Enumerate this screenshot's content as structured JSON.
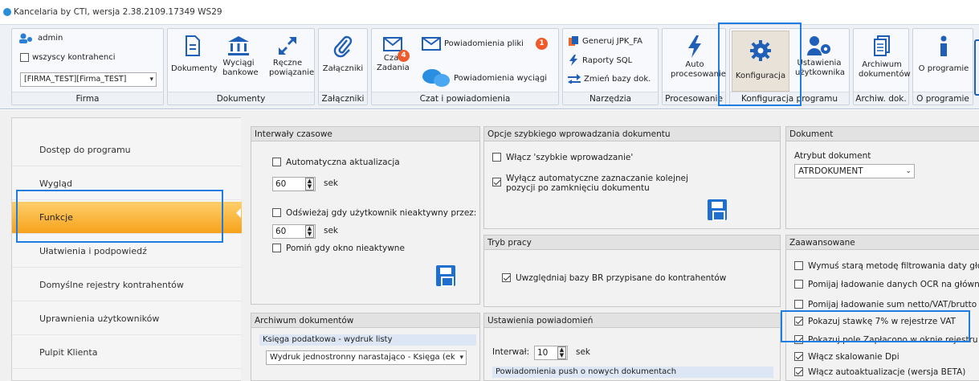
{
  "window": {
    "title": "Kancelaria by CTI, wersja  2.38.2109.17349 WS29"
  },
  "ribbon": {
    "firma": {
      "user": "admin",
      "all_contractors": "wszyscy kontrahenci",
      "firm_select": "[FIRMA_TEST][Firma_TEST]",
      "group_label": "Firma"
    },
    "dokumenty": {
      "dokumenty": "Dokumenty",
      "wyciagi": "Wyciągi bankowe",
      "reczne": "Ręczne powiązanie",
      "group_label": "Dokumenty"
    },
    "zalaczniki": {
      "button": "Załączniki",
      "group_label": "Załączniki"
    },
    "czat": {
      "czat": "Czat",
      "zadania": "Zadania",
      "zadania_badge": "4",
      "powiadomienia_pliki": "Powiadomienia pliki",
      "pliki_badge": "1",
      "powiadomienia_wyciagi": "Powiadomienia wyciągi",
      "group_label": "Czat i powiadomienia"
    },
    "narzedzia": {
      "jpk": "Generuj JPK_FA",
      "raporty": "Raporty SQL",
      "zmien": "Zmień bazy dok.",
      "group_label": "Narzędzia"
    },
    "procesowanie": {
      "button": "Auto procesowanie",
      "group_label": "Procesowanie"
    },
    "konfiguracja": {
      "konfiguracja": "Konfiguracja",
      "ustawienia": "Ustawienia użytkownika",
      "group_label": "Konfiguracja programu"
    },
    "archiwum": {
      "button": "Archiwum dokumentów",
      "group_label": "Archiw. dok."
    },
    "oprogramie": {
      "button": "O programie",
      "group_label": "O programie"
    }
  },
  "sidebar": {
    "items": [
      "Dostęp do programu",
      "Wygląd",
      "Funkcje",
      "Ułatwienia i podpowiedź",
      "Domyślne rejestry kontrahentów",
      "Uprawnienia użytkowników",
      "Pulpit Klienta"
    ]
  },
  "intervals": {
    "title": "Interwały czasowe",
    "auto_update": "Automatyczna aktualizacja",
    "auto_value": "60",
    "sek1": "sek",
    "refresh_idle": "Odświeżaj gdy użytkownik nieaktywny przez:",
    "idle_value": "60",
    "sek2": "sek",
    "skip_inactive": "Pomiń gdy okno nieaktywne"
  },
  "quick_entry": {
    "title": "Opcje szybkiego wprowadzania dokumentu",
    "enable": "Włącz 'szybkie wprowadzanie'",
    "disable_auto_line1": "Wyłącz automatyczne zaznaczanie kolejnej",
    "disable_auto_line2": "pozycji po zamknięciu dokumentu"
  },
  "document": {
    "title": "Dokument",
    "attr_label": "Atrybut dokument",
    "attr_value": "ATRDOKUMENT"
  },
  "work_mode": {
    "title": "Tryb pracy",
    "include_br": "Uwzględniaj bazy BR przypisane do kontrahentów"
  },
  "advanced": {
    "title": "Zaawansowane",
    "items": [
      {
        "label": "Wymuś starą metodę filtrowania daty głównej",
        "checked": false
      },
      {
        "label": "Pomijaj ładowanie danych OCR na głównej liście",
        "checked": false
      },
      {
        "label": "Pomijaj ładowanie sum netto/VAT/brutto na liście",
        "checked": false
      },
      {
        "label": "Pokazuj stawkę 7% w rejestrze VAT",
        "checked": true
      },
      {
        "label": "Pokazuj pole Zapłacono w oknie rejestru",
        "checked": true
      },
      {
        "label": "Włącz skalowanie Dpi",
        "checked": true
      },
      {
        "label": "Włącz autoaktualizacje (wersja BETA)",
        "checked": true
      }
    ]
  },
  "archive": {
    "title": "Archiwum dokumentów",
    "sub_label": "Księga podatkowa - wydruk listy",
    "print_value": "Wydruk jednostronny narastająco - Księga (ek"
  },
  "notifications": {
    "title": "Ustawienia powiadomień",
    "interval_label": "Interwał:",
    "interval_value": "10",
    "sek": "sek",
    "push_label": "Powiadomienia push o nowych dokumentach"
  },
  "colors": {
    "accent": "#1f7ce0",
    "active_item": "#f6a21b"
  }
}
